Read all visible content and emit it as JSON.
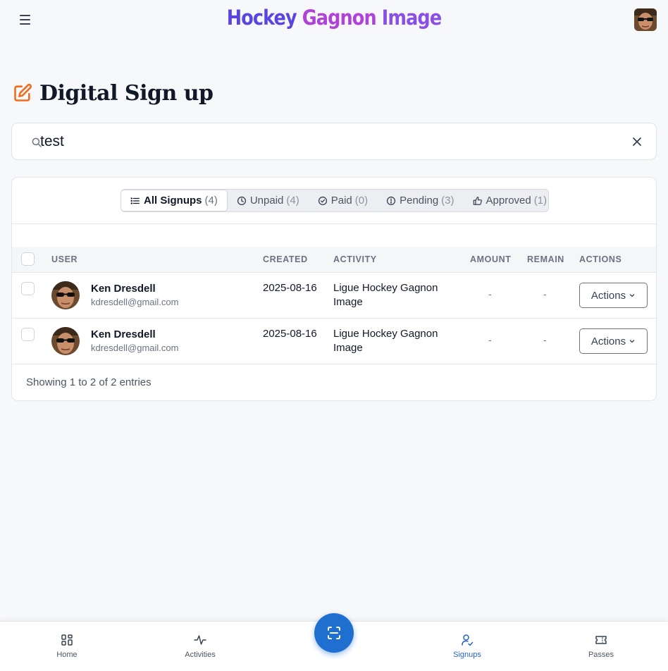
{
  "header": {
    "title_parts": [
      "Hockey ",
      "Gagnon ",
      "Image"
    ]
  },
  "page": {
    "title": "Digital Sign up"
  },
  "search": {
    "value": "test"
  },
  "tabs": [
    {
      "label": "All Signups",
      "count": "(4)"
    },
    {
      "label": "Unpaid",
      "count": "(4)"
    },
    {
      "label": "Paid",
      "count": "(0)"
    },
    {
      "label": "Pending",
      "count": "(3)"
    },
    {
      "label": "Approved",
      "count": "(1)"
    }
  ],
  "table": {
    "columns": [
      "USER",
      "CREATED",
      "ACTIVITY",
      "AMOUNT",
      "REMAIN",
      "ACTIONS"
    ],
    "rows": [
      {
        "name": "Ken Dresdell",
        "email": "kdresdell@gmail.com",
        "created": "2025-08-16",
        "activity": "Ligue Hockey Gagnon Image",
        "amount": "-",
        "remain": "-",
        "action_label": "Actions"
      },
      {
        "name": "Ken Dresdell",
        "email": "kdresdell@gmail.com",
        "created": "2025-08-16",
        "activity": "Ligue Hockey Gagnon Image",
        "amount": "-",
        "remain": "-",
        "action_label": "Actions"
      }
    ],
    "footer": "Showing 1 to 2 of 2 entries"
  },
  "bottom_nav": {
    "items": [
      {
        "label": "Home"
      },
      {
        "label": "Activities"
      },
      {
        "label": "Signups"
      },
      {
        "label": "Passes"
      }
    ],
    "active": "Signups"
  },
  "colors": {
    "accent": "#1f6fd1",
    "title_icon": "#f26b1d",
    "brand_purple": "#5b45e0",
    "brand_magenta": "#b042d9"
  }
}
